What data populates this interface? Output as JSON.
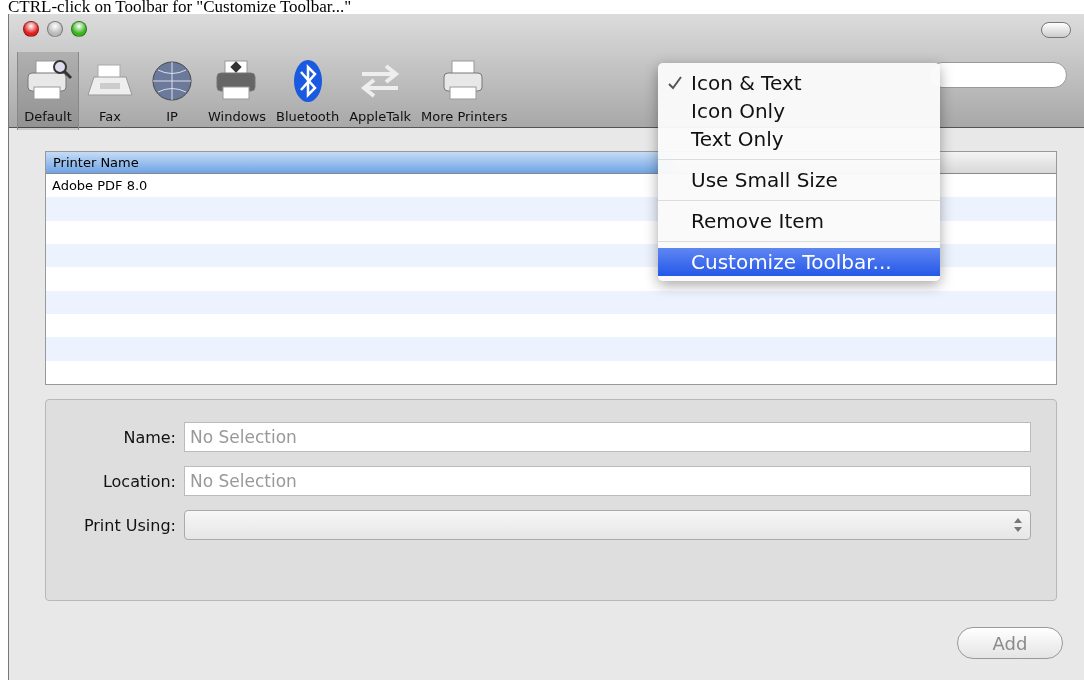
{
  "caption": "CTRL-click on Toolbar for \"Customize Toolbar...\"",
  "toolbar": {
    "items": [
      {
        "label": "Default",
        "selected": true
      },
      {
        "label": "Fax",
        "selected": false
      },
      {
        "label": "IP",
        "selected": false
      },
      {
        "label": "Windows",
        "selected": false
      },
      {
        "label": "Bluetooth",
        "selected": false
      },
      {
        "label": "AppleTalk",
        "selected": false
      },
      {
        "label": "More Printers",
        "selected": false
      }
    ]
  },
  "table": {
    "columns": [
      {
        "label": "Printer Name",
        "selected": true
      }
    ],
    "rows": [
      [
        "Adobe PDF 8.0"
      ]
    ]
  },
  "form": {
    "fields": [
      {
        "kind": "text",
        "label": "Name:",
        "placeholder": "No Selection"
      },
      {
        "kind": "text",
        "label": "Location:",
        "placeholder": "No Selection"
      },
      {
        "kind": "select",
        "label": "Print Using:",
        "disabled": true
      }
    ]
  },
  "add_button": {
    "label": "Add",
    "disabled": true
  },
  "context_menu": {
    "groups": [
      [
        {
          "label": "Icon & Text",
          "checked": true,
          "selected": false
        },
        {
          "label": "Icon Only",
          "checked": false,
          "selected": false
        },
        {
          "label": "Text Only",
          "checked": false,
          "selected": false
        }
      ],
      [
        {
          "label": "Use Small Size",
          "checked": false,
          "selected": false
        }
      ],
      [
        {
          "label": "Remove Item",
          "checked": false,
          "selected": false
        }
      ],
      [
        {
          "label": "Customize Toolbar...",
          "checked": false,
          "selected": true
        }
      ]
    ]
  }
}
